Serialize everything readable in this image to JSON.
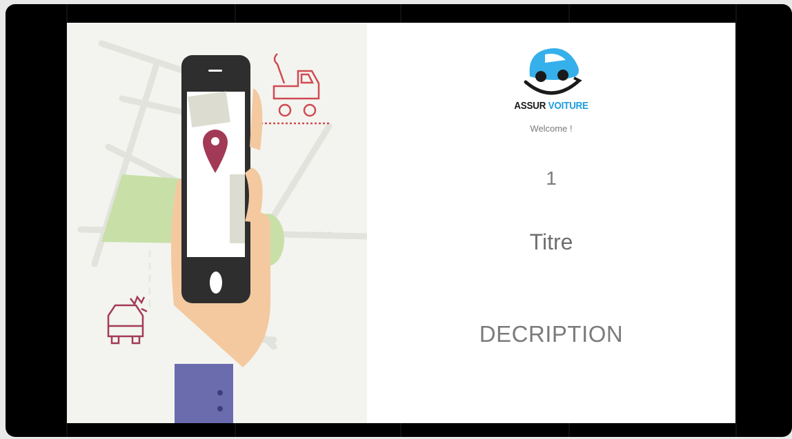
{
  "brand": {
    "word1": "ASSUR",
    "word2": "VOITURE",
    "accent": "#1f9ce0"
  },
  "welcome": "Welcome !",
  "slide_number": "1",
  "title": "Titre",
  "description": "DECRIPTION",
  "illustration": {
    "icons": [
      "tow-truck-icon",
      "crashed-car-icon",
      "map-pin-icon",
      "smartphone-icon"
    ],
    "colors": {
      "accent_red": "#d04a52",
      "pin": "#a33a55",
      "phone": "#2e2e2e",
      "sleeve": "#6a6cae",
      "skin": "#f4c9a0",
      "park": "#c8e0a8"
    }
  }
}
